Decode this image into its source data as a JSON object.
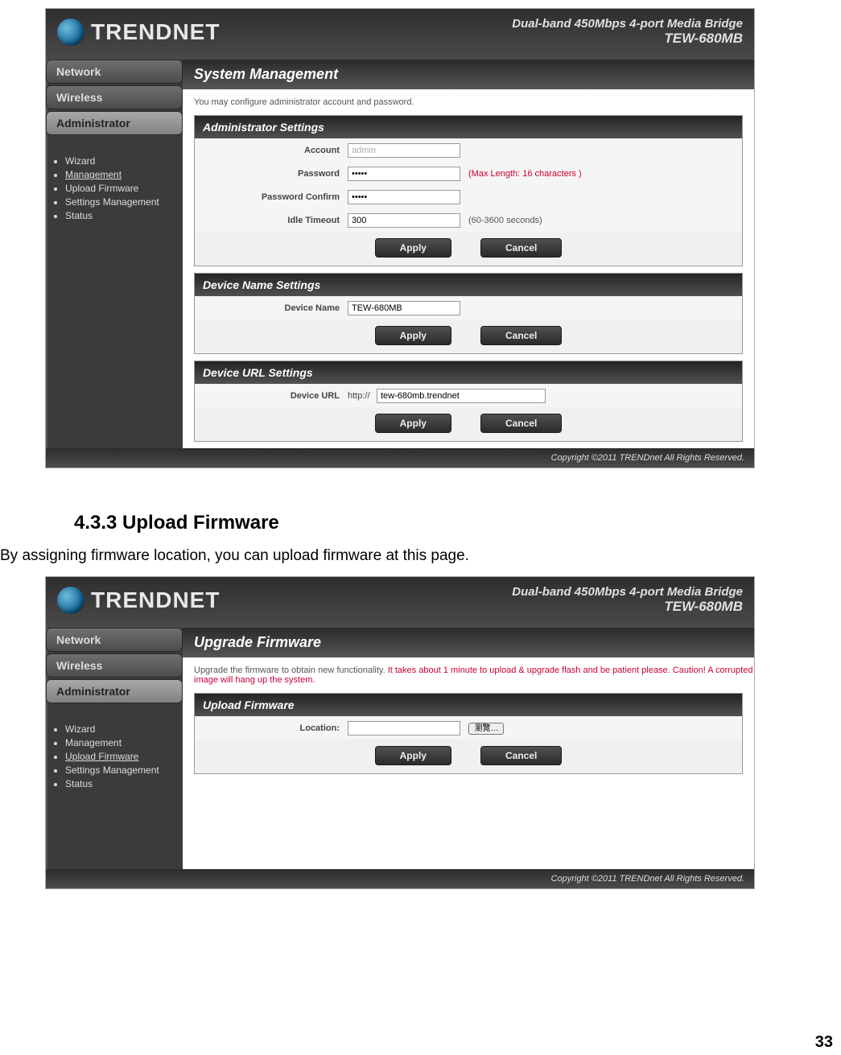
{
  "page_number": "33",
  "doc": {
    "heading": "4.3.3  Upload Firmware",
    "text": "By assigning firmware location, you can upload firmware at this page."
  },
  "shared": {
    "brand": "TRENDNET",
    "tagline1": "Dual-band 450Mbps 4-port Media Bridge",
    "tagline2": "TEW-680MB",
    "copyright": "Copyright ©2011 TRENDnet All Rights Reserved."
  },
  "sidebar": {
    "network": "Network",
    "wireless": "Wireless",
    "administrator": "Administrator",
    "items": [
      "Wizard",
      "Management",
      "Upload Firmware",
      "Settings Management",
      "Status"
    ]
  },
  "buttons": {
    "apply": "Apply",
    "cancel": "Cancel",
    "browse": "瀏覽…"
  },
  "shot1": {
    "title": "System Management",
    "desc": "You may configure administrator account and password.",
    "active_item_index": 1,
    "admin": {
      "heading": "Administrator Settings",
      "account_label": "Account",
      "account_value": "admin",
      "password_label": "Password",
      "password_value": "•••••",
      "password_hint": "(Max Length: 16 characters )",
      "confirm_label": "Password Confirm",
      "confirm_value": "•••••",
      "timeout_label": "Idle Timeout",
      "timeout_value": "300",
      "timeout_hint": "(60-3600 seconds)"
    },
    "devname": {
      "heading": "Device Name Settings",
      "label": "Device Name",
      "value": "TEW-680MB"
    },
    "devurl": {
      "heading": "Device URL Settings",
      "label": "Device URL",
      "prefix": "http://",
      "value": "tew-680mb.trendnet"
    }
  },
  "shot2": {
    "title": "Upgrade Firmware",
    "desc_plain": "Upgrade the firmware to obtain new functionality. ",
    "desc_warn": "It takes about 1 minute to upload & upgrade flash and be patient please. Caution! A corrupted image will hang up the system.",
    "active_item_index": 2,
    "upload": {
      "heading": "Upload Firmware",
      "label": "Location:",
      "value": ""
    }
  }
}
